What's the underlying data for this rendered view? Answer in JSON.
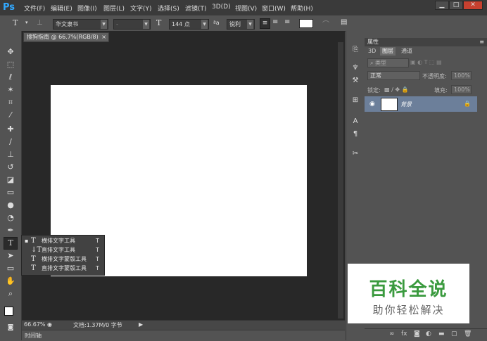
{
  "app": {
    "logo": "Ps"
  },
  "menu": [
    "文件(F)",
    "编辑(E)",
    "图像(I)",
    "图层(L)",
    "文字(Y)",
    "选择(S)",
    "滤镜(T)",
    "3D(D)",
    "视图(V)",
    "窗口(W)",
    "帮助(H)"
  ],
  "window_controls": {
    "minimize": "▁",
    "restore": "□",
    "close": "✕"
  },
  "options": {
    "tool_icon": "T",
    "font_family": "华文隶书",
    "font_style": "-",
    "font_size": "144 点",
    "aa_label": "ªa",
    "antialias": "锐利"
  },
  "document": {
    "tab_title": "搜狗指南 @ 66.7%(RGB/8)",
    "tab_close": "×",
    "zoom": "66.67%",
    "doc_info": "文档:1.37M/0 字节",
    "timeline_label": "时间轴"
  },
  "tools": [
    "move-icon",
    "marquee-icon",
    "lasso-icon",
    "magic-wand-icon",
    "crop-icon",
    "eyedropper-icon",
    "healing-brush-icon",
    "brush-icon",
    "clone-stamp-icon",
    "history-brush-icon",
    "eraser-icon",
    "gradient-icon",
    "blur-icon",
    "dodge-icon",
    "pen-icon",
    "type-icon",
    "path-selection-icon",
    "shape-icon",
    "hand-icon",
    "zoom-icon"
  ],
  "flyout": {
    "items": [
      {
        "label": "横排文字工具",
        "key": "T",
        "selected": true
      },
      {
        "label": "直排文字工具",
        "key": "T",
        "selected": false
      },
      {
        "label": "横排文字蒙版工具",
        "key": "T",
        "selected": false
      },
      {
        "label": "直排文字蒙版工具",
        "key": "T",
        "selected": false
      }
    ]
  },
  "panel": {
    "title": "属性",
    "tabs": [
      "3D",
      "图层",
      "通道"
    ],
    "active_tab": "图层",
    "filter_kind": "类型",
    "blend_mode": "正常",
    "opacity_label": "不透明度:",
    "opacity_value": "100%",
    "lock_label": "锁定:",
    "fill_label": "填充:",
    "fill_value": "100%",
    "layer_name": "背景"
  },
  "watermark": {
    "title": "百科全说",
    "subtitle": "助你轻松解决"
  },
  "colors": {
    "accent": "#31a8ff",
    "layer_selected": "#6c7f9a",
    "watermark_green": "#3a9a3e"
  }
}
